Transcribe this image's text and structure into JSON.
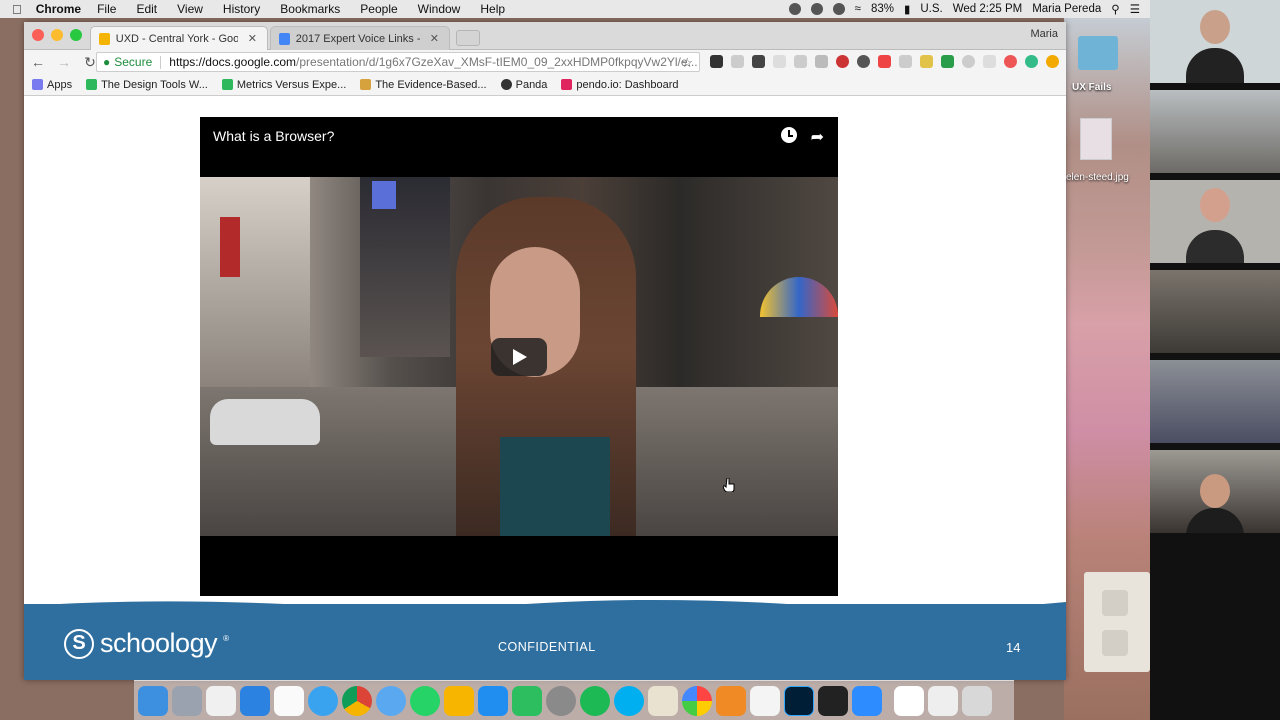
{
  "menubar": {
    "app": "Chrome",
    "items": [
      "File",
      "Edit",
      "View",
      "History",
      "Bookmarks",
      "People",
      "Window",
      "Help"
    ],
    "battery": "83%",
    "input_source": "U.S.",
    "datetime": "Wed 2:25 PM",
    "user": "Maria Pereda"
  },
  "browser": {
    "tabs": [
      {
        "title": "UXD - Central York - Google S",
        "active": true
      },
      {
        "title": "2017 Expert Voice Links - Goo",
        "active": false
      }
    ],
    "profile": "Maria",
    "address": {
      "secure_label": "Secure",
      "url_host": "https://docs.google.com",
      "url_path": "/presentation/d/1g6x7GzeXav_XMsF-tIEM0_09_2xxHDMP0fkpqyVw2Yl/e..."
    },
    "bookmarks": [
      "Apps",
      "The Design Tools W...",
      "Metrics Versus Expe...",
      "The Evidence-Based...",
      "Panda",
      "pendo.io: Dashboard"
    ]
  },
  "slide": {
    "video_title": "What is a Browser?",
    "footer_brand": "schoology",
    "footer_brand_mark": "S",
    "footer_confidential": "CONFIDENTIAL",
    "page_number": "14"
  },
  "desktop": {
    "folder_label": "UX Fails",
    "file_label": "elen-steed.jpg"
  },
  "colors": {
    "footer_blue": "#2f6f9f",
    "secure_green": "#1e8e3e",
    "active_tab": "#f4f4f4"
  }
}
